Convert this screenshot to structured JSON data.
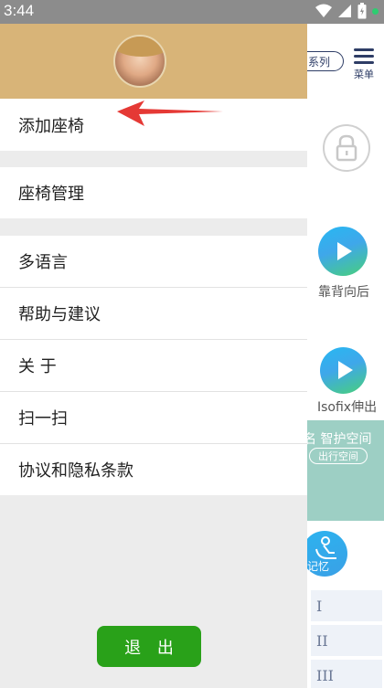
{
  "status_bar": {
    "time": "3:44",
    "icons": [
      "wifi-icon",
      "signal-icon",
      "battery-icon",
      "dot-icon"
    ]
  },
  "drawer": {
    "avatar": "user-avatar",
    "items": [
      {
        "label": "添加座椅"
      },
      {
        "label": "座椅管理"
      },
      {
        "label": "多语言"
      },
      {
        "label": "帮助与建议"
      },
      {
        "label": "关 于"
      },
      {
        "label": "扫一扫"
      },
      {
        "label": "协议和隐私条款"
      }
    ],
    "logout_label": "退 出"
  },
  "background": {
    "series_label": "系列",
    "menu_label": "菜单",
    "recline_label": "靠背向后",
    "isofix_label": "Isofix伸出",
    "banner_title": "智护空间",
    "banner_button": "出行空间",
    "memory_label": "记忆",
    "positions": [
      "I",
      "II",
      "III"
    ]
  },
  "colors": {
    "header_bg": "#d8b478",
    "logout_bg": "#29a119",
    "arrow": "#e53935",
    "status_bar": "#8c8c8c"
  }
}
